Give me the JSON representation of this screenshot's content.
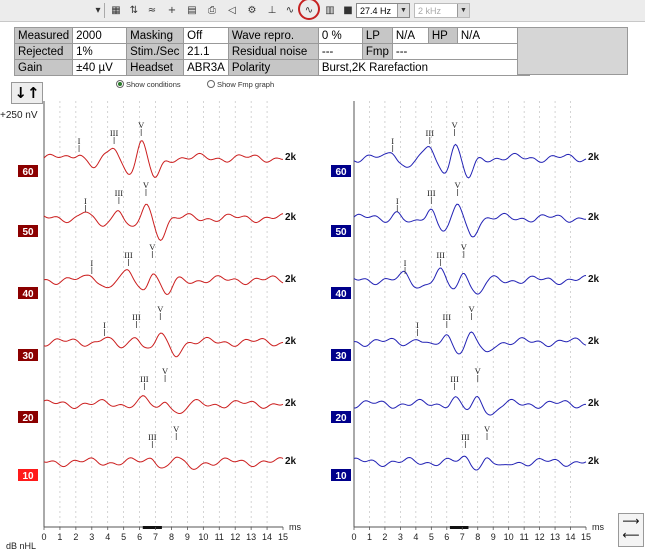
{
  "toolbar": {
    "rate_value": "27.4 Hz",
    "freq_value": "2 kHz",
    "icons": [
      "dropdown-arrow-icon",
      "split-view-icon",
      "sort-icon",
      "compare-icon",
      "add-wave-icon",
      "print-icon",
      "mark-peaks-icon",
      "gear-icon",
      "peak-marker-icon",
      "waveform-select-icon",
      "waveform-highlight-icon",
      "document-icon",
      "record-icon"
    ]
  },
  "info": {
    "measured_label": "Measured",
    "measured_value": "2000",
    "masking_label": "Masking",
    "masking_value": "Off",
    "wave_repro_label": "Wave repro.",
    "wave_repro_value": "0 %",
    "lp_label": "LP",
    "lp_value": "N/A",
    "hp_label": "HP",
    "hp_value": "N/A",
    "rejected_label": "Rejected",
    "rejected_value": "1%",
    "stim_label": "Stim./Sec",
    "stim_value": "21.1",
    "residual_label": "Residual noise",
    "residual_value": "---",
    "fmp_label": "Fmp",
    "fmp_value": "---",
    "gain_label": "Gain",
    "gain_value": "±40 µV",
    "headset_label": "Headset",
    "headset_value": "ABR3A",
    "polarity_label": "Polarity",
    "polarity_value": "Burst,2K Rarefaction"
  },
  "options": {
    "show_conditions": "Show conditions",
    "show_fmp_graph": "Show Fmp graph",
    "show_conditions_selected": true
  },
  "scale_label": "+250 nV",
  "axis": {
    "ticks": [
      "0",
      "1",
      "2",
      "3",
      "4",
      "5",
      "6",
      "7",
      "8",
      "9",
      "10",
      "11",
      "12",
      "13",
      "14",
      "15"
    ],
    "unit": "ms",
    "db_label": "dB nHL"
  },
  "colors": {
    "left_ear": "#cc1f1f",
    "right_ear": "#2323b5",
    "left_badge": "#8b0000",
    "left_badge_active": "#ff1a1a",
    "right_badge": "#00008b"
  },
  "wave_labels": {
    "I": "I",
    "III": "III",
    "V": "V"
  },
  "freq_label": "2k",
  "left_traces": [
    {
      "level": "60",
      "active": false,
      "peaks": {
        "I": 2.2,
        "III": 4.4,
        "V": 6.1
      }
    },
    {
      "level": "50",
      "active": false,
      "peaks": {
        "I": 2.6,
        "III": 4.7,
        "V": 6.4
      }
    },
    {
      "level": "40",
      "active": false,
      "peaks": {
        "I": 3.0,
        "III": 5.3,
        "V": 6.8
      }
    },
    {
      "level": "30",
      "active": false,
      "peaks": {
        "I": 3.8,
        "III": 5.8,
        "V": 7.3
      }
    },
    {
      "level": "20",
      "active": false,
      "peaks": {
        "III": 6.3,
        "V": 7.6
      }
    },
    {
      "level": "10",
      "active": true,
      "peaks": {
        "III": 6.8,
        "V": 8.3
      }
    }
  ],
  "right_traces": [
    {
      "level": "60",
      "peaks": {
        "I": 2.5,
        "III": 4.9,
        "V": 6.5
      }
    },
    {
      "level": "50",
      "peaks": {
        "I": 2.8,
        "III": 5.0,
        "V": 6.7
      }
    },
    {
      "level": "40",
      "peaks": {
        "I": 3.3,
        "III": 5.6,
        "V": 7.1
      }
    },
    {
      "level": "30",
      "peaks": {
        "I": 4.1,
        "III": 6.0,
        "V": 7.6
      }
    },
    {
      "level": "20",
      "peaks": {
        "III": 6.5,
        "V": 8.0
      }
    },
    {
      "level": "10",
      "peaks": {
        "III": 7.2,
        "V": 8.6
      }
    }
  ]
}
